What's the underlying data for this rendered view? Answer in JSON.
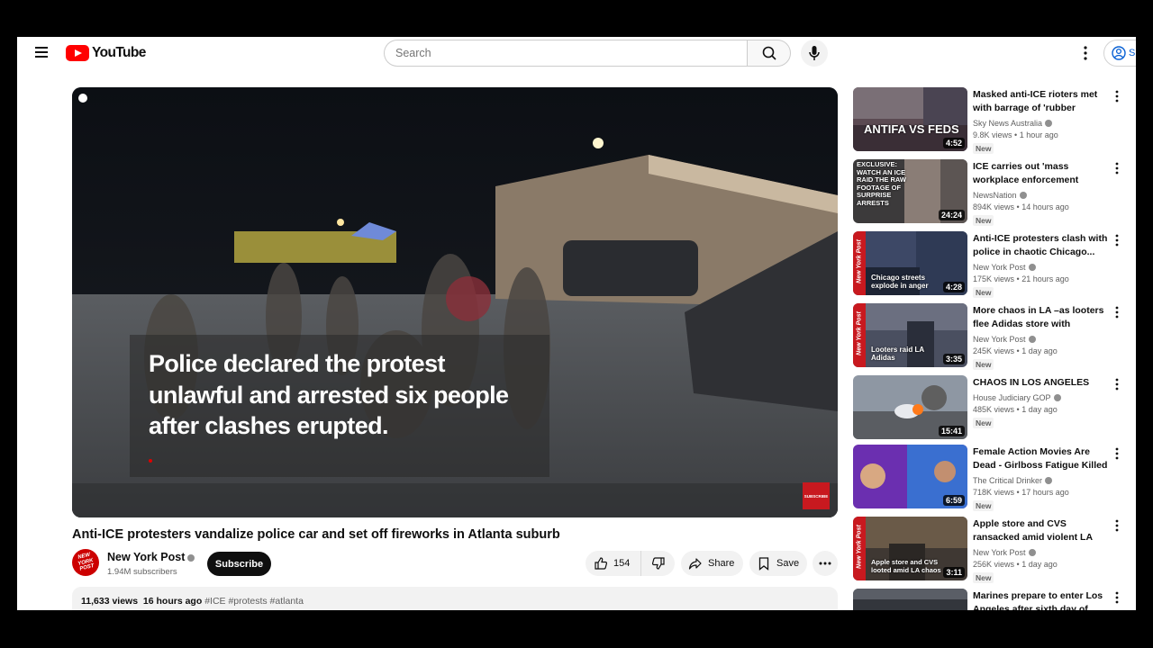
{
  "header": {
    "logo_text": "YouTube",
    "search_placeholder": "Search",
    "signin_label": "S"
  },
  "player": {
    "caption": "Police declared the protest unlawful and arrested six people after clashes erupted.",
    "subscribe_badge": "SUBSCRIBE"
  },
  "video": {
    "title": "Anti-ICE protesters vandalize police car and set off fireworks in Atlanta suburb",
    "channel": "New York Post",
    "channel_logo": "NEW YORK POST",
    "subscribers": "1.94M subscribers",
    "subscribe_label": "Subscribe",
    "likes": "154",
    "share_label": "Share",
    "save_label": "Save",
    "views": "11,633 views",
    "age": "16 hours ago",
    "tags": "#ICE #protests #atlanta"
  },
  "recommendations": [
    {
      "title": "Masked anti-ICE rioters met with barrage of 'rubber bullets'...",
      "channel": "Sky News Australia",
      "views": "9.8K views",
      "age": "1 hour ago",
      "duration": "4:52",
      "badge": "New",
      "thumb_text": "ANTIFA VS FEDS"
    },
    {
      "title": "ICE carries out 'mass workplace enforcement operation':...",
      "channel": "NewsNation",
      "views": "894K views",
      "age": "14 hours ago",
      "duration": "24:24",
      "badge": "New",
      "thumb_text": "EXCLUSIVE: WATCH AN ICE RAID THE RAW FOOTAGE OF SURPRISE ARRESTS"
    },
    {
      "title": "Anti-ICE protesters clash with police in chaotic Chicago...",
      "channel": "New York Post",
      "views": "175K views",
      "age": "21 hours ago",
      "duration": "4:28",
      "badge": "New",
      "thumb_text": "Chicago streets explode in anger"
    },
    {
      "title": "More chaos in LA –as looters flee Adidas store with armfuls...",
      "channel": "New York Post",
      "views": "245K views",
      "age": "1 day ago",
      "duration": "3:35",
      "badge": "New",
      "thumb_text": "Looters raid LA Adidas"
    },
    {
      "title": "CHAOS IN LOS ANGELES",
      "channel": "House Judiciary GOP",
      "views": "485K views",
      "age": "1 day ago",
      "duration": "15:41",
      "badge": "New",
      "thumb_text": ""
    },
    {
      "title": "Female Action Movies Are Dead - Girlboss Fatigue Killed Them",
      "channel": "The Critical Drinker",
      "views": "718K views",
      "age": "17 hours ago",
      "duration": "6:59",
      "badge": "New",
      "thumb_text": ""
    },
    {
      "title": "Apple store and CVS ransacked amid violent LA riots",
      "channel": "New York Post",
      "views": "256K views",
      "age": "1 day ago",
      "duration": "3:11",
      "badge": "New",
      "thumb_text": "Apple store and CVS looted amid LA chaos"
    },
    {
      "title": "Marines prepare to enter Los Angeles after sixth day of",
      "channel": "",
      "views": "",
      "age": "",
      "duration": "",
      "badge": "",
      "thumb_text": ""
    }
  ]
}
